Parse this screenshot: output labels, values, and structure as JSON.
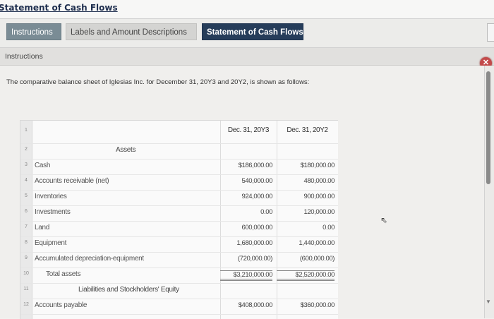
{
  "window": {
    "title": "Statement of Cash Flows"
  },
  "tabs": [
    {
      "label": "Instructions"
    },
    {
      "label": "Labels and Amount Descriptions"
    },
    {
      "label": "Statement of Cash Flows"
    }
  ],
  "section": {
    "label": "Instructions"
  },
  "intro_text": "The comparative balance sheet of Iglesias Inc. for December 31, 20Y3 and 20Y2, is shown as follows:",
  "sheet": {
    "headers": {
      "col1": "Dec. 31, 20Y3",
      "col2": "Dec. 31, 20Y2"
    },
    "row_numbers": [
      "1",
      "2",
      "3",
      "4",
      "5",
      "6",
      "7",
      "8",
      "9",
      "10",
      "11",
      "12"
    ],
    "assets_heading": "Assets",
    "liabilities_heading": "Liabilities and Stockholders' Equity",
    "rows": [
      {
        "label": "Cash",
        "y3": "$186,000.00",
        "y2": "$180,000.00"
      },
      {
        "label": "Accounts receivable (net)",
        "y3": "540,000.00",
        "y2": "480,000.00"
      },
      {
        "label": "Inventories",
        "y3": "924,000.00",
        "y2": "900,000.00"
      },
      {
        "label": "Investments",
        "y3": "0.00",
        "y2": "120,000.00"
      },
      {
        "label": "Land",
        "y3": "600,000.00",
        "y2": "0.00"
      },
      {
        "label": "Equipment",
        "y3": "1,680,000.00",
        "y2": "1,440,000.00"
      },
      {
        "label": "Accumulated depreciation-equipment",
        "y3": "(720,000.00)",
        "y2": "(600,000.00)"
      },
      {
        "label": "Total assets",
        "y3": "$3,210,000.00",
        "y2": "$2,520,000.00"
      },
      {
        "label": "Accounts payable",
        "y3": "$408,000.00",
        "y2": "$360,000.00"
      }
    ]
  }
}
